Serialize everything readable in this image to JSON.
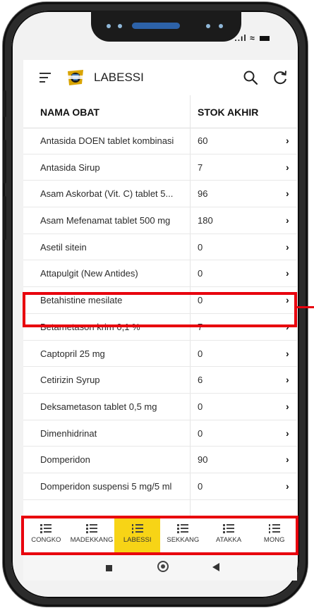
{
  "status_bar": {
    "signal": "..ıl"
  },
  "header": {
    "title": "LABESSI"
  },
  "table": {
    "headers": [
      "NAMA OBAT",
      "STOK AKHIR"
    ],
    "rows": [
      {
        "name": "Antasida DOEN tablet kombinasi",
        "stok": "60"
      },
      {
        "name": "Antasida Sirup",
        "stok": "7"
      },
      {
        "name": "Asam Askorbat (Vit. C) tablet 5...",
        "stok": "96"
      },
      {
        "name": "Asam Mefenamat tablet 500 mg",
        "stok": "180"
      },
      {
        "name": "Asetil sitein",
        "stok": "0"
      },
      {
        "name": "Attapulgit (New Antides)",
        "stok": "0"
      },
      {
        "name": "Betahistine mesilate",
        "stok": "0"
      },
      {
        "name": "Betametason krim 0,1 %",
        "stok": "7"
      },
      {
        "name": "Captopril 25 mg",
        "stok": "0"
      },
      {
        "name": "Cetirizin Syrup",
        "stok": "6"
      },
      {
        "name": "Deksametason tablet 0,5 mg",
        "stok": "0"
      },
      {
        "name": "Dimenhidrinat",
        "stok": "0"
      },
      {
        "name": "Domperidon",
        "stok": "90"
      },
      {
        "name": "Domperidon suspensi 5 mg/5 ml",
        "stok": "0"
      }
    ],
    "chevron": "›"
  },
  "bottom_nav": {
    "items": [
      {
        "label": "CONGKO",
        "active": false
      },
      {
        "label": "MADEKKANG",
        "active": false
      },
      {
        "label": "LABESSI",
        "active": true
      },
      {
        "label": "SEKKANG",
        "active": false
      },
      {
        "label": "ATAKKA",
        "active": false
      },
      {
        "label": "MONG",
        "active": false
      }
    ]
  },
  "colors": {
    "active_tab": "#f7d416",
    "highlight": "#e8000d"
  }
}
